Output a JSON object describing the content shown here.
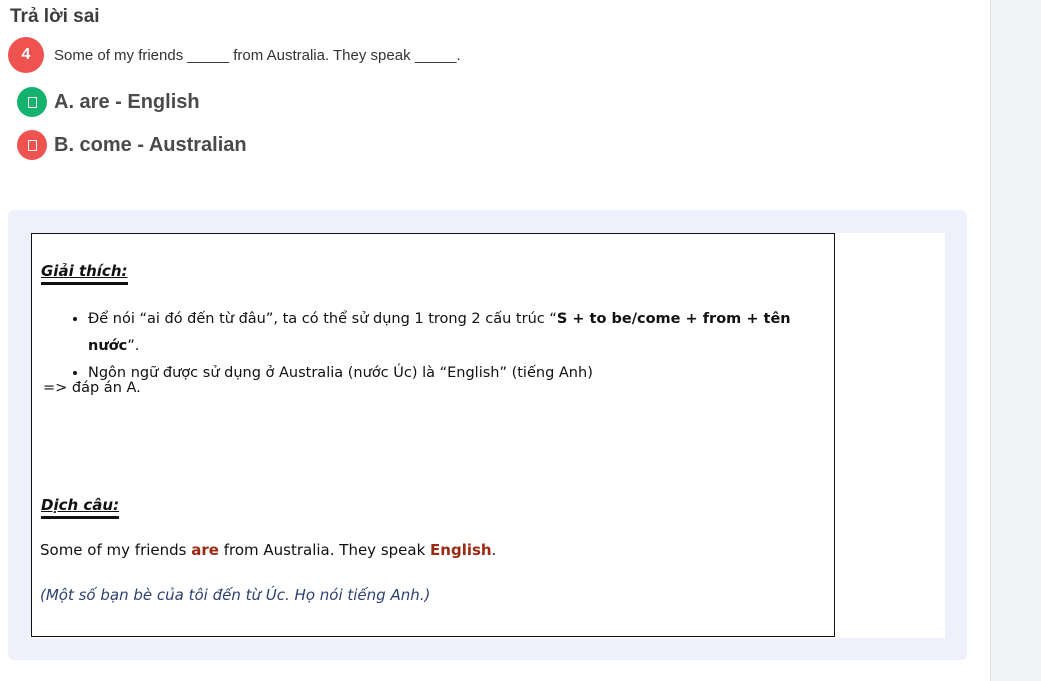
{
  "result": {
    "title": "Trả lời sai"
  },
  "question": {
    "number": "4",
    "text": "Some of my friends _____ from Australia. They speak _____."
  },
  "options": [
    {
      "label": "A. are - English",
      "status": "correct"
    },
    {
      "label": "B. come - Australian",
      "status": "wrong"
    }
  ],
  "explanation": {
    "heading": "Giải thích:",
    "bullets": [
      {
        "prefix": "Để nói “ai đó đến từ đâu”, ta có thể sử dụng 1 trong 2 cấu trúc “",
        "bold": "S + to be/come + from + tên nước",
        "suffix": "”."
      },
      {
        "text": "Ngôn ngữ được sử dụng ở Australia (nước Úc) là “English” (tiếng Anh)"
      }
    ],
    "answer": "=> đáp án A."
  },
  "translation": {
    "heading": "Dịch câu:",
    "sentence": {
      "part1": "Some of my friends ",
      "word1": "are",
      "part2": " from Australia. They speak ",
      "word2": "English",
      "part3": "."
    },
    "vietnamese": "(Một số bạn bè của tôi đến từ Úc. Họ nói tiếng Anh.)"
  },
  "colors": {
    "correct": "#14b36d",
    "wrong": "#ef5350",
    "highlight": "#9b2a12",
    "vietnamese_text": "#2e3f74",
    "panel_bg": "#eef1fb"
  }
}
